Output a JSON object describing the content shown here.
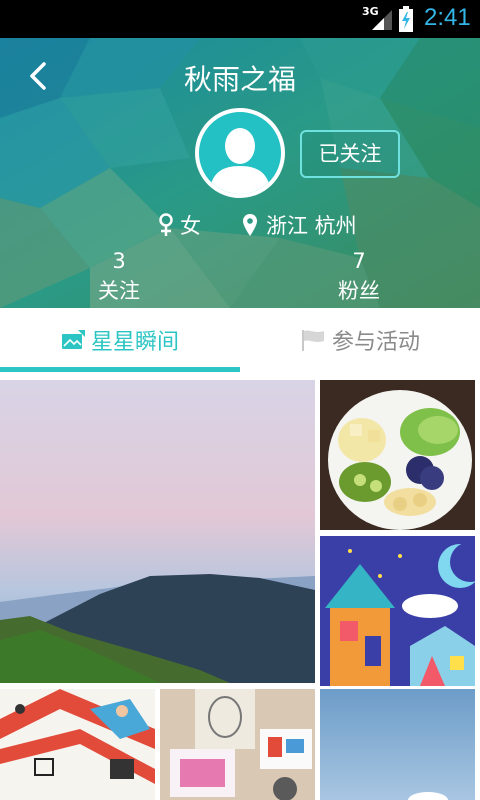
{
  "status_bar": {
    "network": "3G",
    "time": "2:41"
  },
  "header": {
    "title": "秋雨之福",
    "follow_button": "已关注",
    "gender": "女",
    "location": "浙江 杭州",
    "stats": {
      "following_count": "3",
      "following_label": "关注",
      "fans_count": "7",
      "fans_label": "粉丝"
    }
  },
  "tabs": [
    {
      "label": "星星瞬间",
      "icon": "image-icon",
      "active": true
    },
    {
      "label": "参与活动",
      "icon": "flag-icon",
      "active": false
    }
  ],
  "photos": [
    {
      "subject": "misty mountain landscape"
    },
    {
      "subject": "fruit plate"
    },
    {
      "subject": "child drawing of colorful houses"
    },
    {
      "subject": "child drawing with red stripes"
    },
    {
      "subject": "pencil sketches and drawings"
    },
    {
      "subject": "blue sky"
    }
  ],
  "colors": {
    "accent": "#2cc5c3",
    "inactive_tab": "#8a8a8a",
    "status_clock": "#33b5e5"
  }
}
